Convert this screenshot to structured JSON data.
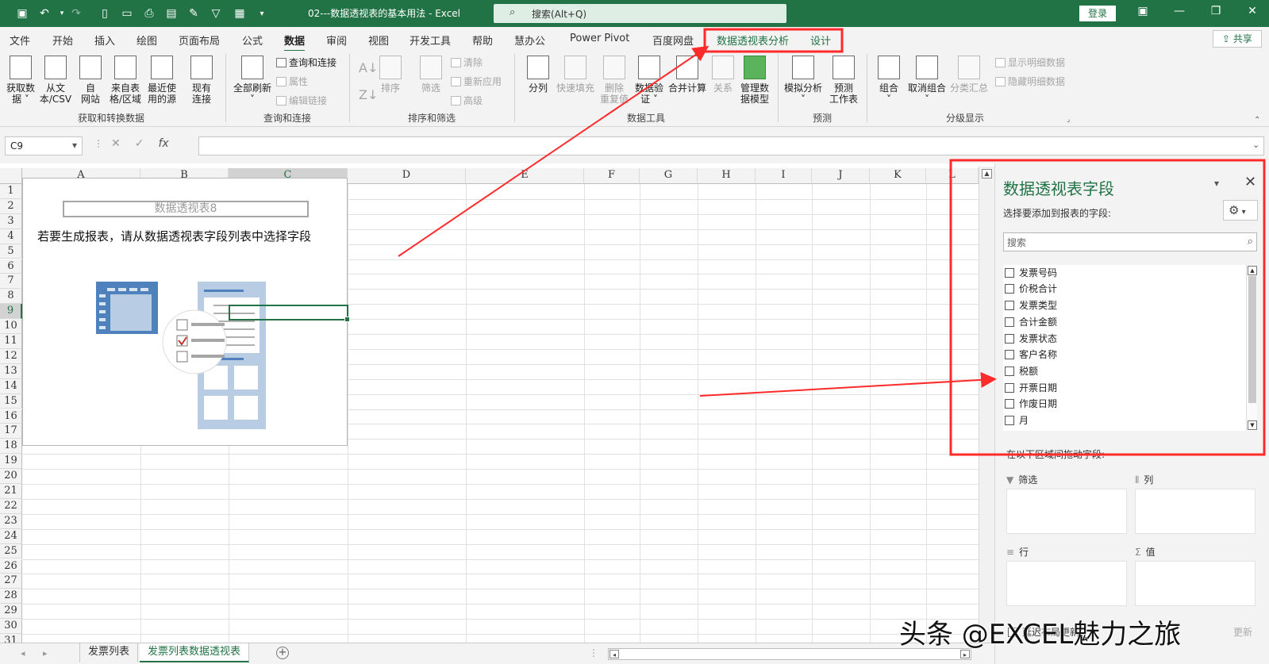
{
  "window": {
    "title": "02---数据透视表的基本用法  -  Excel",
    "search_placeholder": "搜索(Alt+Q)",
    "login": "登录"
  },
  "quick_access": [
    "save-icon",
    "undo-icon",
    "redo-icon",
    "new-icon",
    "open-icon",
    "print-icon",
    "print-preview-icon",
    "format-painter-icon",
    "filter-icon",
    "form-icon",
    "customize-icon"
  ],
  "menu": {
    "tabs": [
      "文件",
      "开始",
      "插入",
      "绘图",
      "页面布局",
      "公式",
      "数据",
      "审阅",
      "视图",
      "开发工具",
      "帮助",
      "慧办公",
      "Power Pivot",
      "百度网盘"
    ],
    "active_tab": "数据",
    "context_tabs": [
      "数据透视表分析",
      "设计"
    ],
    "share": "共享"
  },
  "ribbon": {
    "get_data": {
      "btn1": "获取数\n据 ˅",
      "btn2": "从文\n本/CSV",
      "btn3": "自\n网站",
      "btn4": "来自表\n格/区域",
      "btn5": "最近使\n用的源",
      "btn6": "现有\n连接",
      "group": "获取和转换数据"
    },
    "queries": {
      "refresh": "全部刷新\n˅",
      "conn": "查询和连接",
      "props": "属性",
      "edit_links": "编辑链接",
      "group": "查询和连接"
    },
    "sort": {
      "sort": "排序",
      "filter": "筛选",
      "clear": "清除",
      "reapply": "重新应用",
      "advanced": "高级",
      "group": "排序和筛选"
    },
    "tools": {
      "split": "分列",
      "flash": "快速填充",
      "dedup": "删除\n重复值",
      "validate": "数据验\n证 ˅",
      "consolidate": "合并计算",
      "relation": "关系",
      "model": "管理数\n据模型",
      "group": "数据工具"
    },
    "forecast": {
      "whatif": "模拟分析\n˅",
      "sheet": "预测\n工作表",
      "group": "预测"
    },
    "outline": {
      "grp": "组合\n˅",
      "ungrp": "取消组合\n˅",
      "subtotal": "分类汇总",
      "show": "显示明细数据",
      "hide": "隐藏明细数据",
      "group": "分级显示"
    }
  },
  "formula_bar": {
    "name_box": "C9",
    "fx": "fx",
    "formula": ""
  },
  "columns": [
    "A",
    "B",
    "C",
    "D",
    "E",
    "F",
    "G",
    "H",
    "I",
    "J",
    "K",
    "L"
  ],
  "selected_column": "C",
  "rows": [
    "1",
    "2",
    "3",
    "4",
    "5",
    "6",
    "7",
    "8",
    "9",
    "10",
    "11",
    "12",
    "13",
    "14",
    "15",
    "16",
    "17",
    "18",
    "19",
    "20",
    "21",
    "22",
    "23",
    "24",
    "25",
    "26",
    "27",
    "28",
    "29",
    "30",
    "31"
  ],
  "selected_row": "9",
  "pivot": {
    "name": "数据透视表8",
    "message": "若要生成报表，请从数据透视表字段列表中选择字段"
  },
  "sheets": {
    "tabs": [
      "发票列表",
      "发票列表数据透视表"
    ],
    "active": "发票列表数据透视表"
  },
  "panel": {
    "title": "数据透视表字段",
    "choose_label": "选择要添加到报表的字段:",
    "search_placeholder": "搜索",
    "fields": [
      "发票号码",
      "价税合计",
      "发票类型",
      "合计金额",
      "发票状态",
      "客户名称",
      "税额",
      "开票日期",
      "作废日期",
      "月"
    ],
    "drag_label": "在以下区域间拖动字段:",
    "areas": [
      {
        "name": "筛选",
        "icon": "filter-icon"
      },
      {
        "name": "列",
        "icon": "columns-icon"
      },
      {
        "name": "行",
        "icon": "rows-icon"
      },
      {
        "name": "值",
        "icon": "sigma-icon"
      }
    ],
    "defer": "延迟布局更新",
    "update": "更新"
  },
  "watermark": "头条 @EXCEL魅力之旅",
  "colors": {
    "accent": "#217346",
    "annotation": "#ff2b2b"
  }
}
